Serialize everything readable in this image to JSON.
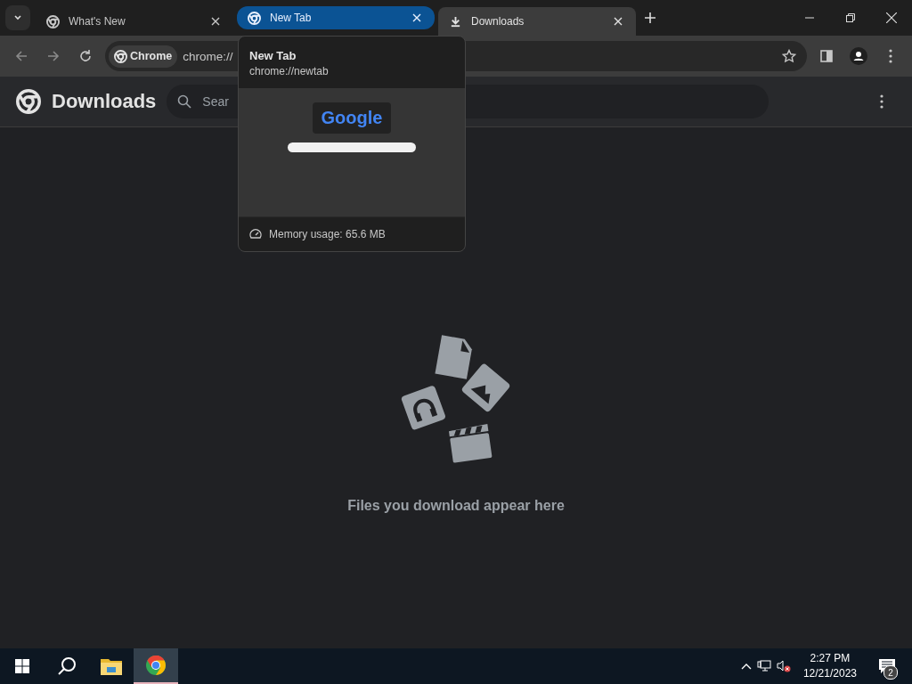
{
  "tabs": [
    {
      "title": "What's New",
      "kind": "page",
      "selected": false,
      "hovered": false
    },
    {
      "title": "New Tab",
      "kind": "page",
      "selected": false,
      "hovered": true
    },
    {
      "title": "Downloads",
      "kind": "download",
      "selected": true,
      "hovered": false
    }
  ],
  "toolbar": {
    "chip": "Chrome",
    "url": "chrome://"
  },
  "page": {
    "title": "Downloads",
    "search_placeholder": "Sear",
    "empty_message": "Files you download appear here"
  },
  "tab_hover_card": {
    "title": "New Tab",
    "url": "chrome://newtab",
    "preview_logo": "Google",
    "memory": "Memory usage: 65.6 MB"
  },
  "taskbar": {
    "apps": [
      {
        "kind": "explorer",
        "selected": false
      },
      {
        "kind": "chrome",
        "selected": true
      }
    ],
    "time": "2:27 PM",
    "date": "12/21/2023",
    "notifications": "2"
  }
}
